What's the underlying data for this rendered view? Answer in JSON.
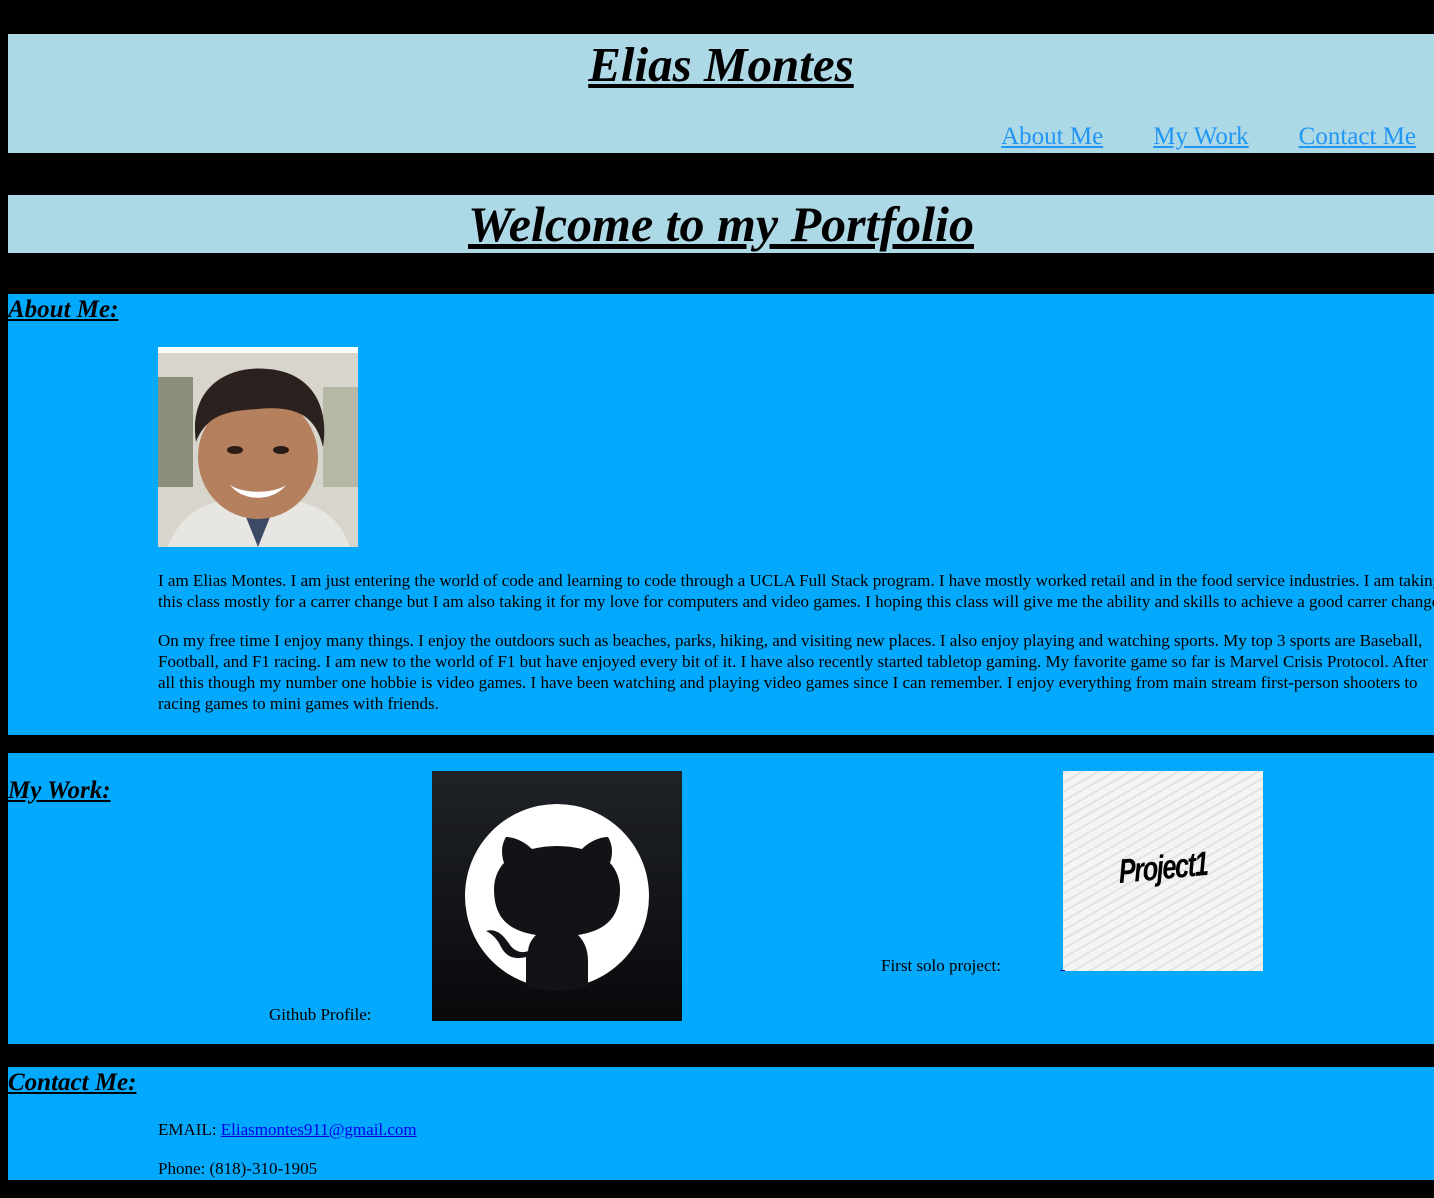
{
  "header": {
    "title": "Elias Montes",
    "nav": [
      "About Me",
      "My Work",
      "Contact Me"
    ]
  },
  "welcome": {
    "title": "Welcome to my Portfolio"
  },
  "about": {
    "heading": "About Me:",
    "paragraph1": "I am Elias Montes. I am just entering the world of code and learning to code through a UCLA Full Stack program. I have mostly worked retail and in the food service industries. I am taking this class mostly for a carrer change but I am also taking it for my love for computers and video games. I hoping this class will give me the ability and skills to achieve a good carrer change.",
    "paragraph2": "On my free time I enjoy many things. I enjoy the outdoors such as beaches, parks, hiking, and visiting new places. I also enjoy playing and watching sports. My top 3 sports are Baseball, Football, and F1 racing. I am new to the world of F1 but have enjoyed every bit of it. I have also recently started tabletop gaming. My favorite game so far is Marvel Crisis Protocol. After all this though my number one hobbie is video games. I have been watching and playing video games since I can remember. I enjoy everything from main stream first-person shooters to racing games to mini games with friends."
  },
  "work": {
    "heading": "My Work:",
    "github_label": "Github Profile:",
    "project_label": "First solo project:",
    "project_thumb_text": "Project1"
  },
  "contact": {
    "heading": "Contact Me:",
    "email_label": "EMAIL:",
    "email": "Eliasmontes911@gmail.com",
    "phone": "Phone: (818)-310-1905"
  },
  "colors": {
    "page_bg": "#000000",
    "header_bg": "#add8e6",
    "section_bg": "#03a9fc",
    "nav_link": "#2196f3",
    "email_link": "#0000ee"
  },
  "icons": [
    "github-icon",
    "profile-photo",
    "project-thumbnail"
  ]
}
